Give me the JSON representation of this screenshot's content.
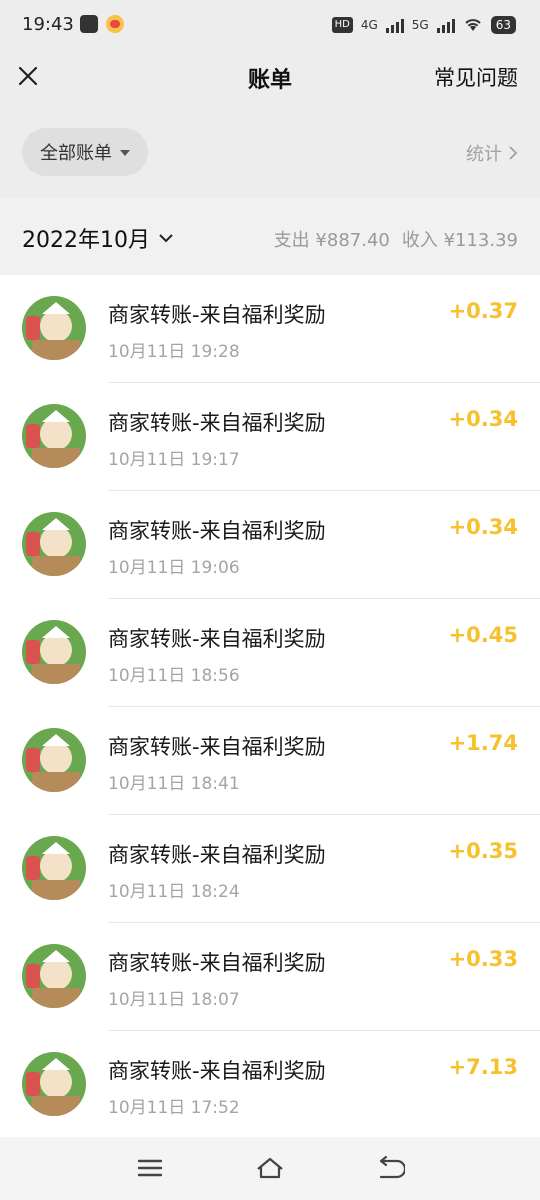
{
  "status_bar": {
    "time": "19:43",
    "left_icons": [
      "message-icon",
      "weibo-icon"
    ],
    "network": [
      "HD",
      "4G",
      "5G"
    ],
    "battery": "63"
  },
  "header": {
    "title": "账单",
    "close_icon": "close-icon",
    "faq_label": "常见问题"
  },
  "filter": {
    "label": "全部账单",
    "stats_label": "统计"
  },
  "month": {
    "label": "2022年10月",
    "summary": "支出 ¥887.40",
    "income": "收入 ¥113.39"
  },
  "transactions": [
    {
      "title": "商家转账-来自福利奖励",
      "time": "10月11日 19:28",
      "amount": "+0.37"
    },
    {
      "title": "商家转账-来自福利奖励",
      "time": "10月11日 19:17",
      "amount": "+0.34"
    },
    {
      "title": "商家转账-来自福利奖励",
      "time": "10月11日 19:06",
      "amount": "+0.34"
    },
    {
      "title": "商家转账-来自福利奖励",
      "time": "10月11日 18:56",
      "amount": "+0.45"
    },
    {
      "title": "商家转账-来自福利奖励",
      "time": "10月11日 18:41",
      "amount": "+1.74"
    },
    {
      "title": "商家转账-来自福利奖励",
      "time": "10月11日 18:24",
      "amount": "+0.35"
    },
    {
      "title": "商家转账-来自福利奖励",
      "time": "10月11日 18:07",
      "amount": "+0.33"
    },
    {
      "title": "商家转账-来自福利奖励",
      "time": "10月11日 17:52",
      "amount": "+7.13"
    }
  ],
  "colors": {
    "income_amount": "#f6c12c",
    "background": "#ededed",
    "list_background": "#ffffff"
  },
  "system_nav": [
    "menu-icon",
    "home-icon",
    "back-icon"
  ]
}
